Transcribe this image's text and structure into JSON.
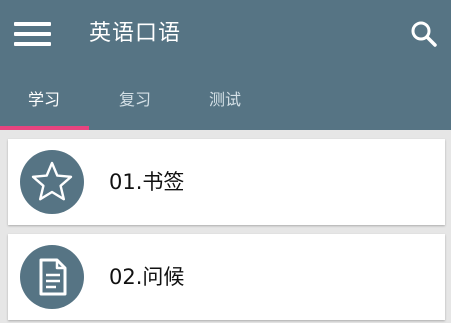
{
  "app": {
    "title": "英语口语",
    "theme_color": "#567484",
    "accent_color": "#e8447f"
  },
  "toolbar": {
    "menu_icon": "hamburger-menu-icon",
    "search_icon": "search-icon"
  },
  "tabs": [
    {
      "label": "学习",
      "active": true
    },
    {
      "label": "复习",
      "active": false
    },
    {
      "label": "测试",
      "active": false
    }
  ],
  "items": [
    {
      "label": "01.书签",
      "icon": "star-icon"
    },
    {
      "label": "02.问候",
      "icon": "document-icon"
    }
  ]
}
